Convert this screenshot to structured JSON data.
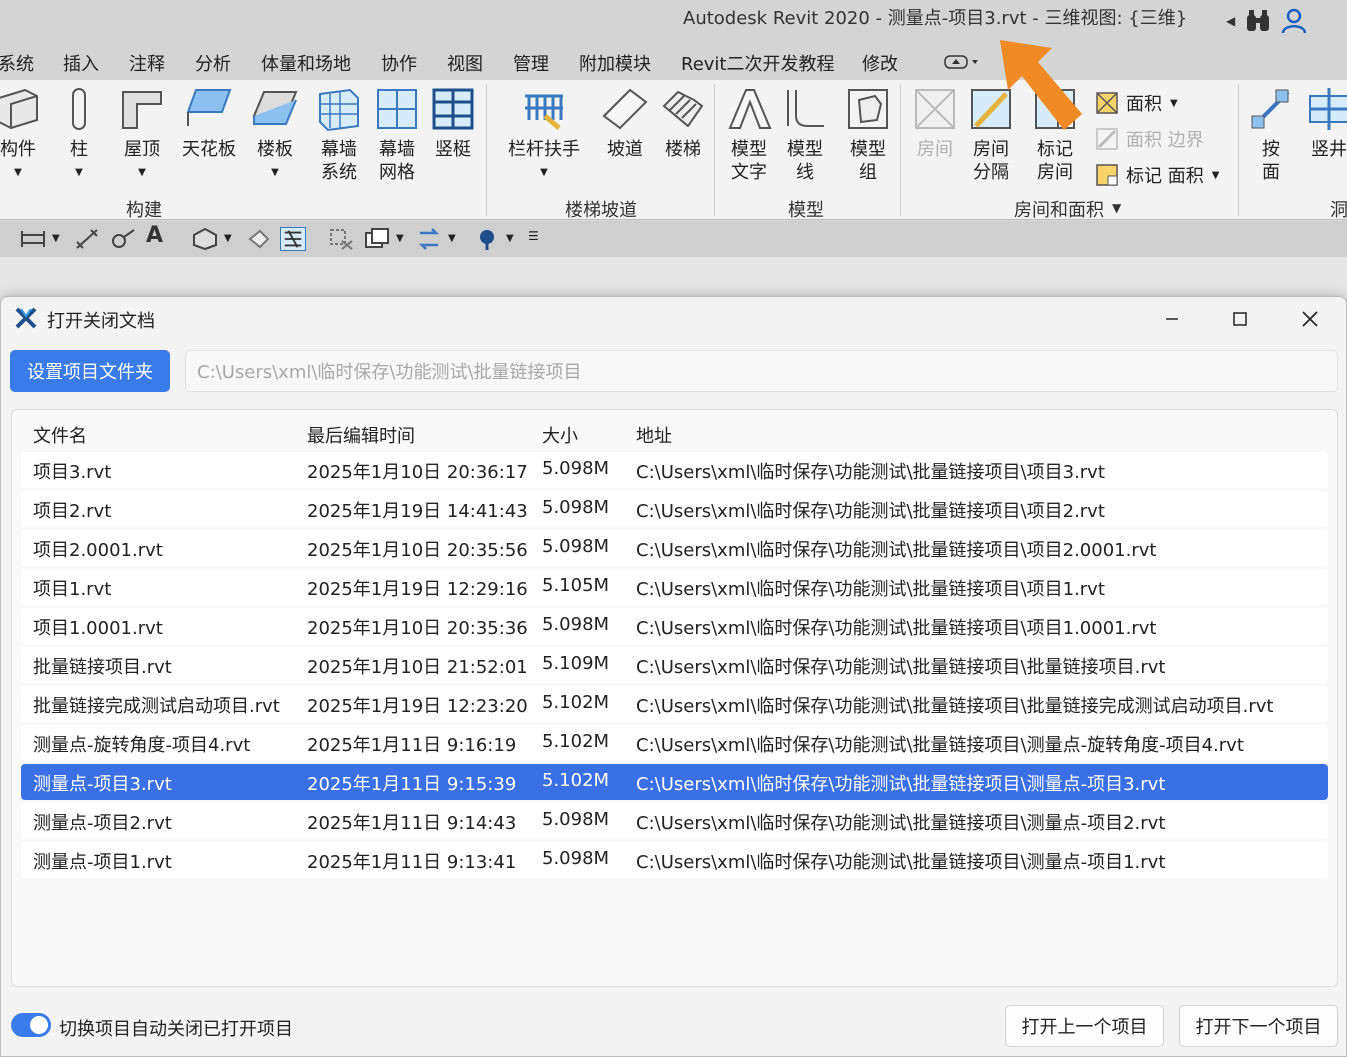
{
  "app": {
    "window_title": "Autodesk Revit 2020 - 测量点-项目3.rvt - 三维视图: {三维}"
  },
  "menu": {
    "tabs": [
      "系统",
      "插入",
      "注释",
      "分析",
      "体量和场地",
      "协作",
      "视图",
      "管理",
      "附加模块",
      "Revit二次开发教程",
      "修改"
    ]
  },
  "ribbon": {
    "build": {
      "component": "构件",
      "column": "柱",
      "roof": "屋顶",
      "ceiling": "天花板",
      "floor": "楼板",
      "curtain_system_1": "幕墙",
      "curtain_system_2": "系统",
      "curtain_grid_1": "幕墙",
      "curtain_grid_2": "网格",
      "mullion": "竖梃",
      "label": "构建"
    },
    "stairs": {
      "railing": "栏杆扶手",
      "ramp": "坡道",
      "stair": "楼梯",
      "label": "楼梯坡道"
    },
    "model": {
      "text_1": "模型",
      "text_2": "文字",
      "line_1": "模型",
      "line_2": "线",
      "group_1": "模型",
      "group_2": "组",
      "label": "模型"
    },
    "room": {
      "room": "房间",
      "separator_1": "房间",
      "separator_2": "分隔",
      "tag_1": "标记",
      "tag_2": "房间",
      "area": "面积",
      "area_boundary": "面积 边界",
      "tag_area": "标记 面积",
      "label": "房间和面积"
    },
    "opening": {
      "byface_1": "按",
      "byface_2": "面",
      "shaft": "竖井",
      "label": "洞"
    }
  },
  "dialog": {
    "title": "打开关闭文档",
    "set_folder_button": "设置项目文件夹",
    "folder_path": "C:\\Users\\xml\\临时保存\\功能测试\\批量链接项目",
    "columns": {
      "name": "文件名",
      "modified": "最后编辑时间",
      "size": "大小",
      "path": "地址"
    },
    "files": [
      {
        "name": "项目3.rvt",
        "modified": "2025年1月10日 20:36:17",
        "size": "5.098M",
        "path": "C:\\Users\\xml\\临时保存\\功能测试\\批量链接项目\\项目3.rvt"
      },
      {
        "name": "项目2.rvt",
        "modified": "2025年1月19日 14:41:43",
        "size": "5.098M",
        "path": "C:\\Users\\xml\\临时保存\\功能测试\\批量链接项目\\项目2.rvt"
      },
      {
        "name": "项目2.0001.rvt",
        "modified": "2025年1月10日 20:35:56",
        "size": "5.098M",
        "path": "C:\\Users\\xml\\临时保存\\功能测试\\批量链接项目\\项目2.0001.rvt"
      },
      {
        "name": "项目1.rvt",
        "modified": "2025年1月19日 12:29:16",
        "size": "5.105M",
        "path": "C:\\Users\\xml\\临时保存\\功能测试\\批量链接项目\\项目1.rvt"
      },
      {
        "name": "项目1.0001.rvt",
        "modified": "2025年1月10日 20:35:36",
        "size": "5.098M",
        "path": "C:\\Users\\xml\\临时保存\\功能测试\\批量链接项目\\项目1.0001.rvt"
      },
      {
        "name": "批量链接项目.rvt",
        "modified": "2025年1月10日 21:52:01",
        "size": "5.109M",
        "path": "C:\\Users\\xml\\临时保存\\功能测试\\批量链接项目\\批量链接项目.rvt"
      },
      {
        "name": "批量链接完成测试启动项目.rvt",
        "modified": "2025年1月19日 12:23:20",
        "size": "5.102M",
        "path": "C:\\Users\\xml\\临时保存\\功能测试\\批量链接项目\\批量链接完成测试启动项目.rvt"
      },
      {
        "name": "测量点-旋转角度-项目4.rvt",
        "modified": "2025年1月11日 9:16:19",
        "size": "5.102M",
        "path": "C:\\Users\\xml\\临时保存\\功能测试\\批量链接项目\\测量点-旋转角度-项目4.rvt"
      },
      {
        "name": "测量点-项目3.rvt",
        "modified": "2025年1月11日 9:15:39",
        "size": "5.102M",
        "path": "C:\\Users\\xml\\临时保存\\功能测试\\批量链接项目\\测量点-项目3.rvt"
      },
      {
        "name": "测量点-项目2.rvt",
        "modified": "2025年1月11日 9:14:43",
        "size": "5.098M",
        "path": "C:\\Users\\xml\\临时保存\\功能测试\\批量链接项目\\测量点-项目2.rvt"
      },
      {
        "name": "测量点-项目1.rvt",
        "modified": "2025年1月11日 9:13:41",
        "size": "5.098M",
        "path": "C:\\Users\\xml\\临时保存\\功能测试\\批量链接项目\\测量点-项目1.rvt"
      }
    ],
    "selected_index": 8,
    "auto_close_toggle": true,
    "auto_close_label": "切换项目自动关闭已打开项目",
    "prev_button": "打开上一个项目",
    "next_button": "打开下一个项目"
  },
  "colors": {
    "accent": "#3a7bea",
    "selected_row": "#3a6fe6",
    "annotation_arrow": "#f08a24"
  },
  "icons": [
    "binoculars-icon",
    "user-icon",
    "minimize-icon",
    "maximize-icon",
    "close-icon",
    "app-logo-icon"
  ]
}
